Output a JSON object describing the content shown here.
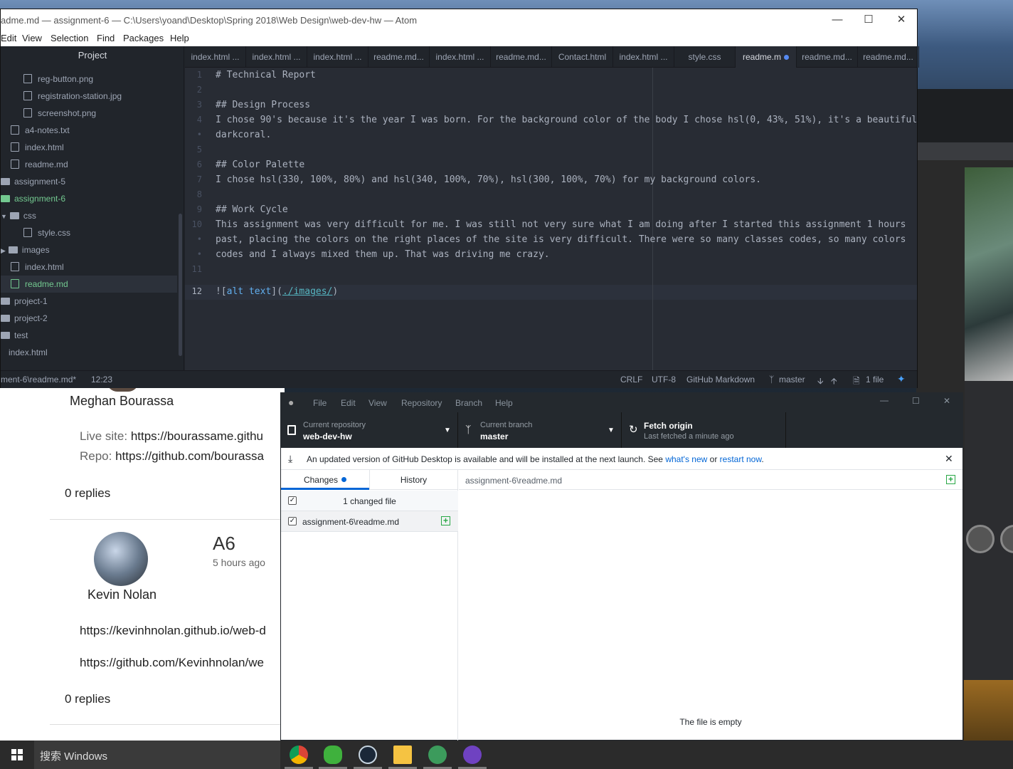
{
  "atom": {
    "title": "adme.md — assignment-6 — C:\\Users\\yoand\\Desktop\\Spring 2018\\Web Design\\web-dev-hw — Atom",
    "menu": [
      "Edit",
      "View",
      "Selection",
      "Find",
      "Packages",
      "Help"
    ],
    "tree_header": "Project",
    "tree": [
      {
        "label": "reg-button.png"
      },
      {
        "label": "registration-station.jpg"
      },
      {
        "label": "screenshot.png"
      },
      {
        "label": "a4-notes.txt"
      },
      {
        "label": "index.html"
      },
      {
        "label": "readme.md"
      },
      {
        "label": "assignment-5"
      },
      {
        "label": "assignment-6"
      },
      {
        "label": "css"
      },
      {
        "label": "style.css"
      },
      {
        "label": "images"
      },
      {
        "label": "index.html"
      },
      {
        "label": "readme.md"
      },
      {
        "label": "project-1"
      },
      {
        "label": "project-2"
      },
      {
        "label": "test"
      },
      {
        "label": "index.html"
      }
    ],
    "tabs": [
      "index.html ...",
      "index.html ...",
      "index.html ...",
      "readme.md...",
      "index.html ...",
      "readme.md...",
      "Contact.html",
      "index.html ...",
      "style.css",
      "readme.m",
      "readme.md...",
      "readme.md..."
    ],
    "line_numbers": [
      "1",
      "2",
      "3",
      "4",
      "5",
      "6",
      "7",
      "8",
      "9",
      "10",
      "•",
      "•",
      "11",
      "12"
    ],
    "lines": {
      "l1": "# Technical Report",
      "l3": "## Design Process",
      "l4a": "I chose 90's because it's the year I was born. For the background color of the body I chose hsl(0, 43%, 51%), it's a beautiful",
      "l4b": "darkcoral.",
      "l6": "## Color Palette",
      "l7": "I chose hsl(330, 100%, 80%) and hsl(340, 100%, 70%), hsl(300, 100%, 70%) for my background colors.",
      "l9": "## Work Cycle",
      "l10a": "This assignment was very difficult for me. I was still not very sure what I am doing after I started this assignment 1 hours",
      "l10b": "past, placing the colors on the right places of the site is very difficult. There were so many classes codes, so many colors",
      "l10c": "codes and I always mixed them up. That was driving me crazy.",
      "l12_bang": "![",
      "l12_alt": "alt text",
      "l12_mid": "](",
      "l12_url": "./images/",
      "l12_end": ")"
    },
    "status": {
      "file": "ment-6\\readme.md*",
      "cursor": "12:23",
      "eol": "CRLF",
      "encoding": "UTF-8",
      "grammar": "GitHub Markdown",
      "branch": "master",
      "files": "1 file"
    }
  },
  "forum": {
    "user1": "Meghan Bourassa",
    "live_site": "Live site: ",
    "live_url": "https://bourassame.githu",
    "repo": "Repo: ",
    "repo_url": "https://github.com/bourassa",
    "replies1": "0 replies",
    "post_title": "A6",
    "post_time": "5 hours ago",
    "user2": "Kevin Nolan",
    "link1": "https://kevinhnolan.github.io/web-d",
    "link2": "https://github.com/Kevinhnolan/we",
    "replies2": "0 replies"
  },
  "github": {
    "menu": [
      "File",
      "Edit",
      "View",
      "Repository",
      "Branch",
      "Help"
    ],
    "repo_label": "Current repository",
    "repo_value": "web-dev-hw",
    "branch_label": "Current branch",
    "branch_value": "master",
    "fetch_label": "Fetch origin",
    "fetch_sub": "Last fetched a minute ago",
    "banner_text": "An updated version of GitHub Desktop is available and will be installed at the next launch. See ",
    "banner_link1": "what's new",
    "banner_or": " or ",
    "banner_link2": "restart now",
    "banner_end": ".",
    "tab_changes": "Changes",
    "tab_history": "History",
    "changed_count": "1 changed file",
    "file_path": "assignment-6\\readme.md",
    "diff_path": "assignment-6\\readme.md",
    "empty_msg": "The file is empty"
  },
  "taskbar": {
    "search": "搜索 Windows"
  }
}
